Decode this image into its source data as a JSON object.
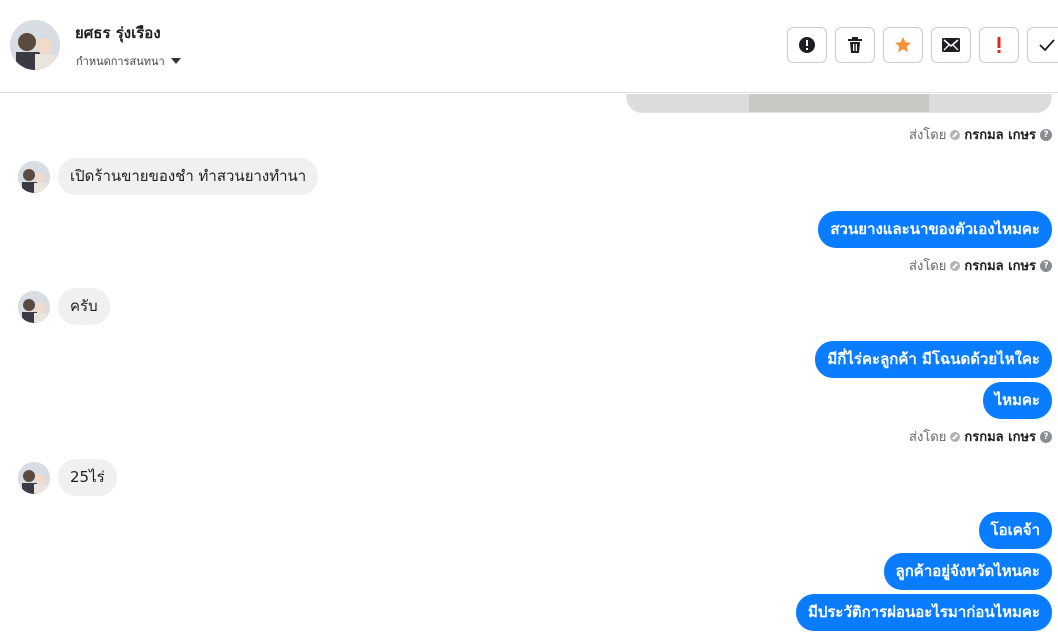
{
  "contact": {
    "name": "ยศธร รุ่งเรือง",
    "label_dropdown": "กำหนดการสนทนา"
  },
  "actions": [
    {
      "name": "mark-spam-button",
      "icon": "alert-circle-icon"
    },
    {
      "name": "delete-button",
      "icon": "trash-icon"
    },
    {
      "name": "star-button",
      "icon": "star-icon",
      "color": "#f7923a"
    },
    {
      "name": "mark-unread-button",
      "icon": "envelope-icon"
    },
    {
      "name": "important-button",
      "icon": "exclamation-icon",
      "color": "#e0241b"
    },
    {
      "name": "done-button",
      "icon": "check-icon"
    }
  ],
  "colors": {
    "outgoing_bubble": "#0a7cff",
    "incoming_bubble": "#f0f0f0"
  },
  "sent_by": {
    "prefix": "ส่งโดย",
    "agent": "กรกมล เกษร",
    "help": "?"
  },
  "messages": {
    "in1": "เปิดร้านขายของชำ ทำสวนยางทำนา",
    "out1": "สวนยางและนาของตัวเองไหมคะ",
    "in2": "ครับ",
    "out2": "มีกี่ไร่คะลูกค้า มีโฉนดด้วยไหใคะ",
    "out3": "ไหมคะ",
    "in3": "25ไร่",
    "out4": "โอเคจ้า",
    "out5": "ลูกค้าอยู่จังหวัดไหนคะ",
    "out6": "มีประวัติการผ่อนอะไรมาก่อนไหมคะ"
  }
}
